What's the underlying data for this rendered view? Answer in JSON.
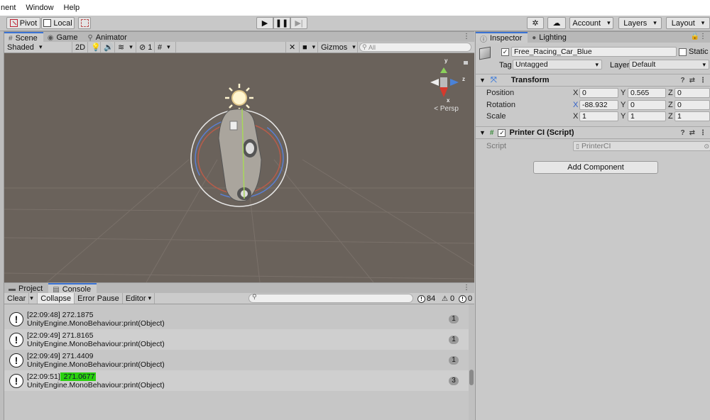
{
  "menubar": {
    "items": [
      "nent",
      "Window",
      "Help"
    ]
  },
  "toolbar": {
    "pivot_label": "Pivot",
    "local_label": "Local",
    "account_label": "Account",
    "layers_label": "Layers",
    "layout_label": "Layout"
  },
  "scene_tabs": [
    {
      "label": "Scene",
      "icon": "grid-icon"
    },
    {
      "label": "Game",
      "icon": "gamepad-icon"
    },
    {
      "label": "Animator",
      "icon": "animator-icon"
    }
  ],
  "scene_toolbar": {
    "shading_mode": "Shaded",
    "mode_2d": "2D",
    "layer_count": "1",
    "gizmos_label": "Gizmos",
    "search_placeholder": "All"
  },
  "scene_view": {
    "projection_label": "< Persp",
    "axis_y": "y",
    "axis_x": "x",
    "axis_z": "z"
  },
  "console_tabs": [
    {
      "label": "Project",
      "icon": "folder-icon"
    },
    {
      "label": "Console",
      "icon": "console-icon"
    }
  ],
  "console_toolbar": {
    "clear_label": "Clear",
    "collapse_label": "Collapse",
    "error_pause_label": "Error Pause",
    "editor_label": "Editor",
    "info_count": "84",
    "warning_count": "0",
    "error_count": "0"
  },
  "console_entries": [
    {
      "line1": "[22:09:48] 272.1875",
      "line2": "UnityEngine.MonoBehaviour:print(Object)",
      "count": "1",
      "highlight": ""
    },
    {
      "line1": "[22:09:49] 271.8165",
      "line2": "UnityEngine.MonoBehaviour:print(Object)",
      "count": "1",
      "highlight": ""
    },
    {
      "line1": "[22:09:49] 271.4409",
      "line2": "UnityEngine.MonoBehaviour:print(Object)",
      "count": "1",
      "highlight": ""
    },
    {
      "line1": "[22:09:51]",
      "line2": "UnityEngine.MonoBehaviour:print(Object)",
      "count": "3",
      "highlight": " 271.0677"
    }
  ],
  "inspector": {
    "tabs": [
      {
        "label": "Inspector",
        "icon": "info-icon"
      },
      {
        "label": "Lighting",
        "icon": "bulb-icon"
      }
    ],
    "object_name": "Free_Racing_Car_Blue",
    "static_label": "Static",
    "tag_label": "Tag",
    "tag_value": "Untagged",
    "layer_label": "Layer",
    "layer_value": "Default",
    "transform": {
      "title": "Transform",
      "position": {
        "label": "Position",
        "x": "0",
        "y": "0.565",
        "z": "0"
      },
      "rotation": {
        "label": "Rotation",
        "x": "-88.932",
        "y": "0",
        "z": "0"
      },
      "scale": {
        "label": "Scale",
        "x": "1",
        "y": "1",
        "z": "1"
      }
    },
    "script_component": {
      "title": "Printer CI (Script)",
      "script_label": "Script",
      "script_value": "PrinterCI"
    },
    "add_component_label": "Add Component"
  },
  "colors": {
    "accent": "#3a72d4",
    "highlight": "#2ad10e",
    "scene_bg": "#6a625b"
  }
}
